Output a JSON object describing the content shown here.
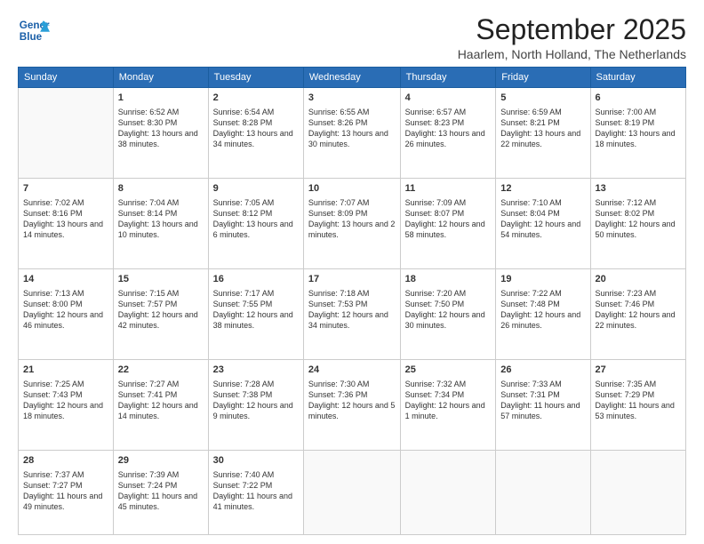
{
  "logo": {
    "line1": "General",
    "line2": "Blue"
  },
  "title": "September 2025",
  "location": "Haarlem, North Holland, The Netherlands",
  "weekdays": [
    "Sunday",
    "Monday",
    "Tuesday",
    "Wednesday",
    "Thursday",
    "Friday",
    "Saturday"
  ],
  "weeks": [
    [
      {
        "day": "",
        "sunrise": "",
        "sunset": "",
        "daylight": ""
      },
      {
        "day": "1",
        "sunrise": "Sunrise: 6:52 AM",
        "sunset": "Sunset: 8:30 PM",
        "daylight": "Daylight: 13 hours and 38 minutes."
      },
      {
        "day": "2",
        "sunrise": "Sunrise: 6:54 AM",
        "sunset": "Sunset: 8:28 PM",
        "daylight": "Daylight: 13 hours and 34 minutes."
      },
      {
        "day": "3",
        "sunrise": "Sunrise: 6:55 AM",
        "sunset": "Sunset: 8:26 PM",
        "daylight": "Daylight: 13 hours and 30 minutes."
      },
      {
        "day": "4",
        "sunrise": "Sunrise: 6:57 AM",
        "sunset": "Sunset: 8:23 PM",
        "daylight": "Daylight: 13 hours and 26 minutes."
      },
      {
        "day": "5",
        "sunrise": "Sunrise: 6:59 AM",
        "sunset": "Sunset: 8:21 PM",
        "daylight": "Daylight: 13 hours and 22 minutes."
      },
      {
        "day": "6",
        "sunrise": "Sunrise: 7:00 AM",
        "sunset": "Sunset: 8:19 PM",
        "daylight": "Daylight: 13 hours and 18 minutes."
      }
    ],
    [
      {
        "day": "7",
        "sunrise": "Sunrise: 7:02 AM",
        "sunset": "Sunset: 8:16 PM",
        "daylight": "Daylight: 13 hours and 14 minutes."
      },
      {
        "day": "8",
        "sunrise": "Sunrise: 7:04 AM",
        "sunset": "Sunset: 8:14 PM",
        "daylight": "Daylight: 13 hours and 10 minutes."
      },
      {
        "day": "9",
        "sunrise": "Sunrise: 7:05 AM",
        "sunset": "Sunset: 8:12 PM",
        "daylight": "Daylight: 13 hours and 6 minutes."
      },
      {
        "day": "10",
        "sunrise": "Sunrise: 7:07 AM",
        "sunset": "Sunset: 8:09 PM",
        "daylight": "Daylight: 13 hours and 2 minutes."
      },
      {
        "day": "11",
        "sunrise": "Sunrise: 7:09 AM",
        "sunset": "Sunset: 8:07 PM",
        "daylight": "Daylight: 12 hours and 58 minutes."
      },
      {
        "day": "12",
        "sunrise": "Sunrise: 7:10 AM",
        "sunset": "Sunset: 8:04 PM",
        "daylight": "Daylight: 12 hours and 54 minutes."
      },
      {
        "day": "13",
        "sunrise": "Sunrise: 7:12 AM",
        "sunset": "Sunset: 8:02 PM",
        "daylight": "Daylight: 12 hours and 50 minutes."
      }
    ],
    [
      {
        "day": "14",
        "sunrise": "Sunrise: 7:13 AM",
        "sunset": "Sunset: 8:00 PM",
        "daylight": "Daylight: 12 hours and 46 minutes."
      },
      {
        "day": "15",
        "sunrise": "Sunrise: 7:15 AM",
        "sunset": "Sunset: 7:57 PM",
        "daylight": "Daylight: 12 hours and 42 minutes."
      },
      {
        "day": "16",
        "sunrise": "Sunrise: 7:17 AM",
        "sunset": "Sunset: 7:55 PM",
        "daylight": "Daylight: 12 hours and 38 minutes."
      },
      {
        "day": "17",
        "sunrise": "Sunrise: 7:18 AM",
        "sunset": "Sunset: 7:53 PM",
        "daylight": "Daylight: 12 hours and 34 minutes."
      },
      {
        "day": "18",
        "sunrise": "Sunrise: 7:20 AM",
        "sunset": "Sunset: 7:50 PM",
        "daylight": "Daylight: 12 hours and 30 minutes."
      },
      {
        "day": "19",
        "sunrise": "Sunrise: 7:22 AM",
        "sunset": "Sunset: 7:48 PM",
        "daylight": "Daylight: 12 hours and 26 minutes."
      },
      {
        "day": "20",
        "sunrise": "Sunrise: 7:23 AM",
        "sunset": "Sunset: 7:46 PM",
        "daylight": "Daylight: 12 hours and 22 minutes."
      }
    ],
    [
      {
        "day": "21",
        "sunrise": "Sunrise: 7:25 AM",
        "sunset": "Sunset: 7:43 PM",
        "daylight": "Daylight: 12 hours and 18 minutes."
      },
      {
        "day": "22",
        "sunrise": "Sunrise: 7:27 AM",
        "sunset": "Sunset: 7:41 PM",
        "daylight": "Daylight: 12 hours and 14 minutes."
      },
      {
        "day": "23",
        "sunrise": "Sunrise: 7:28 AM",
        "sunset": "Sunset: 7:38 PM",
        "daylight": "Daylight: 12 hours and 9 minutes."
      },
      {
        "day": "24",
        "sunrise": "Sunrise: 7:30 AM",
        "sunset": "Sunset: 7:36 PM",
        "daylight": "Daylight: 12 hours and 5 minutes."
      },
      {
        "day": "25",
        "sunrise": "Sunrise: 7:32 AM",
        "sunset": "Sunset: 7:34 PM",
        "daylight": "Daylight: 12 hours and 1 minute."
      },
      {
        "day": "26",
        "sunrise": "Sunrise: 7:33 AM",
        "sunset": "Sunset: 7:31 PM",
        "daylight": "Daylight: 11 hours and 57 minutes."
      },
      {
        "day": "27",
        "sunrise": "Sunrise: 7:35 AM",
        "sunset": "Sunset: 7:29 PM",
        "daylight": "Daylight: 11 hours and 53 minutes."
      }
    ],
    [
      {
        "day": "28",
        "sunrise": "Sunrise: 7:37 AM",
        "sunset": "Sunset: 7:27 PM",
        "daylight": "Daylight: 11 hours and 49 minutes."
      },
      {
        "day": "29",
        "sunrise": "Sunrise: 7:39 AM",
        "sunset": "Sunset: 7:24 PM",
        "daylight": "Daylight: 11 hours and 45 minutes."
      },
      {
        "day": "30",
        "sunrise": "Sunrise: 7:40 AM",
        "sunset": "Sunset: 7:22 PM",
        "daylight": "Daylight: 11 hours and 41 minutes."
      },
      {
        "day": "",
        "sunrise": "",
        "sunset": "",
        "daylight": ""
      },
      {
        "day": "",
        "sunrise": "",
        "sunset": "",
        "daylight": ""
      },
      {
        "day": "",
        "sunrise": "",
        "sunset": "",
        "daylight": ""
      },
      {
        "day": "",
        "sunrise": "",
        "sunset": "",
        "daylight": ""
      }
    ]
  ]
}
